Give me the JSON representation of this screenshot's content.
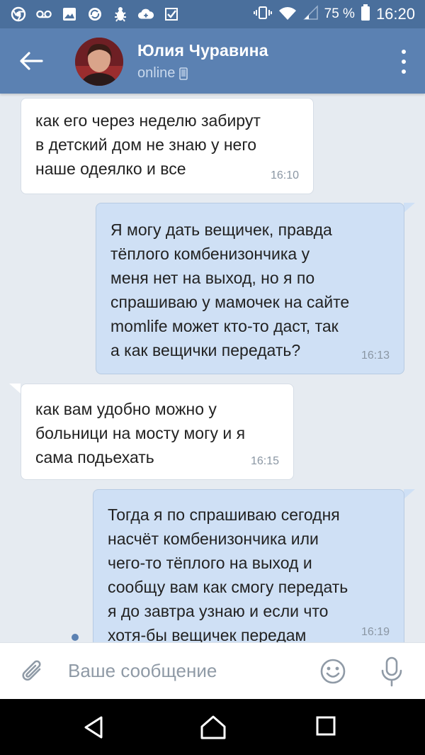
{
  "status_bar": {
    "left_icons": [
      "chrome-icon",
      "voicemail-icon",
      "gallery-icon",
      "sync-icon",
      "bug-icon",
      "cloud-icon",
      "checkmark-icon"
    ],
    "battery_percent": "75 %",
    "time": "16:20"
  },
  "header": {
    "contact_name": "Юлия Чуравина",
    "status": "online",
    "status_icon": "phone-icon"
  },
  "messages": [
    {
      "direction": "in",
      "text": "как его через неделю забирут\nв детский дом не знаю у него\nнаше одеялко и все",
      "time": "16:10"
    },
    {
      "direction": "out",
      "text": "Я могу дать вещичек, правда\nтёплого комбенизончика у\nменя нет на выход, но я по\nспрашиваю у мамочек на сайте\nmomlife может кто-то даст, так\nа как вещички передать?",
      "time": "16:13"
    },
    {
      "direction": "in",
      "text": "как вам удобно можно у\nбольници на мосту могу и я\nсама подьехать",
      "time": "16:15"
    },
    {
      "direction": "out",
      "text": "Тогда я по спрашиваю сегодня\nнасчёт комбенизончика или\nчего-то тёплого на выход и\nсообщу вам как смогу передать\nя до завтра узнаю и если что\nхотя-бы вещичек передам",
      "time": "16:19"
    }
  ],
  "input": {
    "placeholder": "Ваше сообщение"
  },
  "colors": {
    "header": "#5b81b2",
    "status_bar": "#4a6f9c",
    "chat_bg": "#e6ebf1",
    "outgoing_bubble": "#cfe0f5",
    "incoming_bubble": "#ffffff"
  }
}
